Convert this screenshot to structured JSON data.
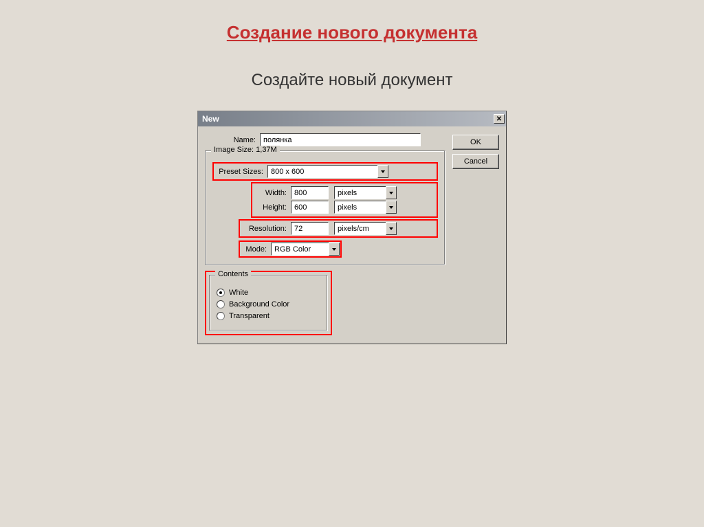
{
  "page": {
    "title": "Создание нового документа",
    "subtitle": "Создайте новый документ"
  },
  "dialog": {
    "title": "New",
    "buttons": {
      "ok": "OK",
      "cancel": "Cancel"
    },
    "labels": {
      "name": "Name:",
      "image_size_group": "Image Size: 1,37M",
      "preset": "Preset Sizes:",
      "width": "Width:",
      "height": "Height:",
      "resolution": "Resolution:",
      "mode": "Mode:",
      "contents_group": "Contents"
    },
    "values": {
      "name": "полянка",
      "preset": "800 x 600",
      "width": "800",
      "width_unit": "pixels",
      "height": "600",
      "height_unit": "pixels",
      "resolution": "72",
      "resolution_unit": "pixels/cm",
      "mode": "RGB Color"
    },
    "contents": {
      "white": "White",
      "bg": "Background Color",
      "transparent": "Transparent",
      "selected": "white"
    }
  }
}
